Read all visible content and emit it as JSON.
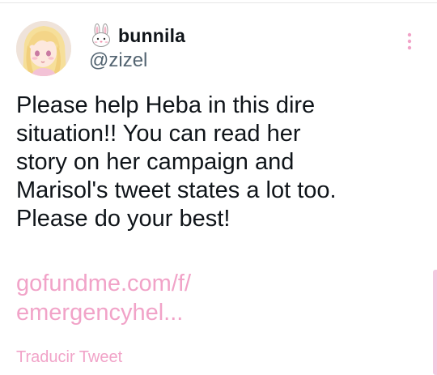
{
  "tweet": {
    "author": {
      "display_name": "bunnila",
      "handle": "@zizel",
      "name_emoji": "rabbit-face-icon"
    },
    "text": "Please help Heba in this dire\nsituation!! You can read her\nstory on her campaign and\nMarisol's tweet states a lot too.\nPlease do your best!",
    "link_text": "gofundme.com/f/\nemergencyhel...",
    "translate_label": "Traducir Tweet"
  },
  "colors": {
    "accent": "#f1a3c8",
    "text": "#0f1419",
    "secondary_text": "#536471",
    "more_icon": "#f1a3c8"
  }
}
